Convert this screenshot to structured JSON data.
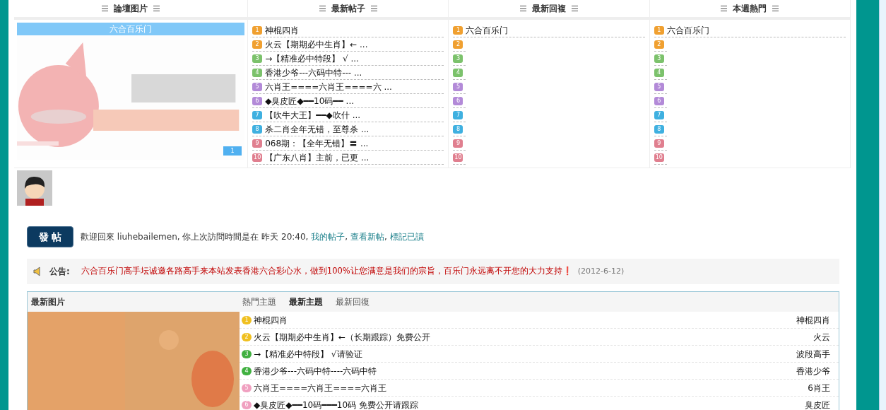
{
  "top_panel": {
    "columns": [
      {
        "title": "論壇图片",
        "kind": "slideshow",
        "caption": "六合百乐门",
        "slide_button": "1"
      },
      {
        "title": "最新帖子",
        "kind": "list",
        "items": [
          {
            "rank": "1",
            "color": "#f0a030",
            "text": "神棍四肖"
          },
          {
            "rank": "2",
            "color": "#f0a030",
            "text": "火云【期期必中生肖】← ..."
          },
          {
            "rank": "3",
            "color": "#7cc26c",
            "text": "→【精准必中特段】 √ ..."
          },
          {
            "rank": "4",
            "color": "#7cc26c",
            "text": "香港少爷---六码中特--- ..."
          },
          {
            "rank": "5",
            "color": "#b38ad8",
            "text": "六肖王====六肖王====六  ..."
          },
          {
            "rank": "6",
            "color": "#b38ad8",
            "text": "◆臭皮匠◆━━10码━━ ..."
          },
          {
            "rank": "7",
            "color": "#3fb0e0",
            "text": "【吹牛大王】━━◆吹什  ..."
          },
          {
            "rank": "8",
            "color": "#3fb0e0",
            "text": "杀二肖全年无错，至尊杀  ..."
          },
          {
            "rank": "9",
            "color": "#e07f8f",
            "text": "068期：【全年无错】〓  ..."
          },
          {
            "rank": "10",
            "color": "#e07f8f",
            "text": "【广东八肖】主前，已更  ..."
          }
        ]
      },
      {
        "title": "最新回複",
        "kind": "list",
        "items": [
          {
            "rank": "1",
            "color": "#f0a030",
            "text": "六合百乐门"
          },
          {
            "rank": "2",
            "color": "#f0a030"
          },
          {
            "rank": "3",
            "color": "#7cc26c"
          },
          {
            "rank": "4",
            "color": "#7cc26c"
          },
          {
            "rank": "5",
            "color": "#b38ad8"
          },
          {
            "rank": "6",
            "color": "#b38ad8"
          },
          {
            "rank": "7",
            "color": "#3fb0e0"
          },
          {
            "rank": "8",
            "color": "#3fb0e0"
          },
          {
            "rank": "9",
            "color": "#e07f8f"
          },
          {
            "rank": "10",
            "color": "#e07f8f"
          }
        ]
      },
      {
        "title": "本週熱門",
        "kind": "list",
        "items": [
          {
            "rank": "1",
            "color": "#f0a030",
            "text": "六合百乐门"
          },
          {
            "rank": "2",
            "color": "#f0a030"
          },
          {
            "rank": "3",
            "color": "#7cc26c"
          },
          {
            "rank": "4",
            "color": "#7cc26c"
          },
          {
            "rank": "5",
            "color": "#b38ad8"
          },
          {
            "rank": "6",
            "color": "#b38ad8"
          },
          {
            "rank": "7",
            "color": "#3fb0e0"
          },
          {
            "rank": "8",
            "color": "#3fb0e0"
          },
          {
            "rank": "9",
            "color": "#e07f8f"
          },
          {
            "rank": "10",
            "color": "#e07f8f"
          }
        ]
      }
    ]
  },
  "post_button": "發 帖",
  "welcome": {
    "text": "歡迎回來  liuhebailemen, 你上次訪問時間是在  昨天 20:40,",
    "links": [
      "我的帖子",
      "查看新帖",
      "標記已讀"
    ],
    "separator": ","
  },
  "announcement": {
    "label": "公告:",
    "text": "六合百乐门高手坛诚邀各路高手来本站发表香港六合彩心水，做到100%让您满意是我们的宗旨，百乐门永远离不开您的大力支持❗",
    "date": "(2012-6-12)"
  },
  "bottom_panel": {
    "picture_title": "最新图片",
    "tabs": [
      {
        "label": "熱門主題",
        "selected": false
      },
      {
        "label": "最新主題",
        "selected": true
      },
      {
        "label": "最新回復",
        "selected": false
      }
    ],
    "rows": [
      {
        "rank": "1",
        "color": "#f0c020",
        "title": "神棍四肖",
        "author": "神棍四肖"
      },
      {
        "rank": "2",
        "color": "#f0c020",
        "title": "火云【期期必中生肖】←（长期跟踪）免费公开",
        "author": "火云"
      },
      {
        "rank": "3",
        "color": "#40b040",
        "title": "→【精准必中特段】 √请验证",
        "author": "波段高手"
      },
      {
        "rank": "4",
        "color": "#40b040",
        "title": "香港少爷---六码中特----六码中特",
        "author": "香港少爷"
      },
      {
        "rank": "5",
        "color": "#f0a0c0",
        "title": "六肖王====六肖王====六肖王",
        "author": "6肖王"
      },
      {
        "rank": "6",
        "color": "#f0a0c0",
        "title": "◆臭皮匠◆━━10码━━━10码 免费公开请跟踪",
        "author": "臭皮匠"
      }
    ]
  }
}
